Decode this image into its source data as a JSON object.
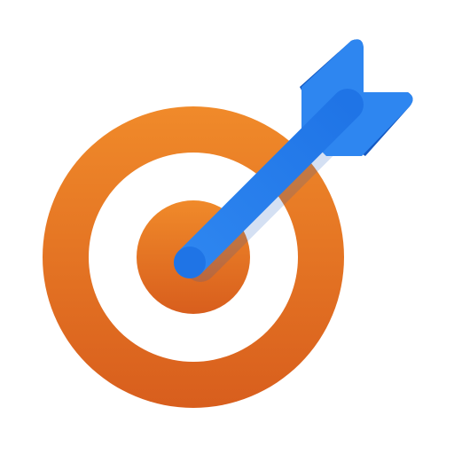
{
  "icon": {
    "name": "target-with-dart",
    "colors": {
      "ring_top": "#F08A2A",
      "ring_bottom": "#D85E1D",
      "ring_shadow": "#B9541A",
      "inner_white": "#FFFFFF",
      "bullseye_top": "#F08A2A",
      "bullseye_bottom": "#D85E1D",
      "dart_light": "#2E86F0",
      "dart_mid": "#1F74E6",
      "dart_dark": "#1559C2"
    }
  }
}
